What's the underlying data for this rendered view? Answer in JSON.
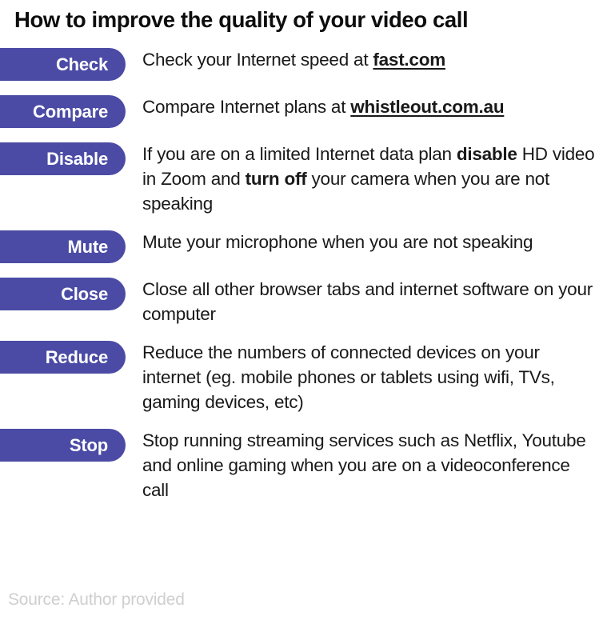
{
  "title": "How to improve the quality of your video call",
  "theme": {
    "pill_color": "#4b4ba6",
    "pill_text_color": "#ffffff",
    "title_color": "#0d0d0d",
    "body_text_color": "#191919",
    "source_color": "#cfcfcf",
    "background": "#ffffff"
  },
  "tips": [
    {
      "label": "Check",
      "text": "Check your Internet speed at fast.com",
      "segments": [
        {
          "text": "Check your Internet speed at ",
          "style": "normal"
        },
        {
          "text": "fast.com",
          "style": "link"
        }
      ]
    },
    {
      "label": "Compare",
      "text": "Compare Internet plans at whistleout.com.au",
      "segments": [
        {
          "text": "Compare Internet plans at ",
          "style": "normal"
        },
        {
          "text": "whistleout.com.au",
          "style": "link"
        }
      ]
    },
    {
      "label": "Disable",
      "text": "If you are on a limited Internet data plan disable HD video in Zoom and turn off your camera when you are not speaking",
      "segments": [
        {
          "text": "If you are on a limited Internet data plan ",
          "style": "normal"
        },
        {
          "text": "disable",
          "style": "bold"
        },
        {
          "text": " HD video in Zoom and ",
          "style": "normal"
        },
        {
          "text": "turn off",
          "style": "bold"
        },
        {
          "text": " your camera when you are not speaking",
          "style": "normal"
        }
      ]
    },
    {
      "label": "Mute",
      "text": "Mute your microphone when you are not speaking",
      "segments": [
        {
          "text": "Mute your microphone when you are not speaking",
          "style": "normal"
        }
      ]
    },
    {
      "label": "Close",
      "text": "Close all other browser tabs and internet software on your computer",
      "segments": [
        {
          "text": "Close all other browser tabs and internet software on your computer",
          "style": "normal"
        }
      ]
    },
    {
      "label": "Reduce",
      "text": "Reduce the numbers of connected devices on your internet (eg. mobile phones or tablets using wifi, TVs, gaming devices, etc)",
      "segments": [
        {
          "text": "Reduce the numbers of connected devices on your internet (eg. mobile phones or tablets using wifi, TVs, gaming devices, etc)",
          "style": "normal"
        }
      ]
    },
    {
      "label": "Stop",
      "text": "Stop running streaming services such as Netflix, Youtube and online gaming when you are on a videoconference call",
      "segments": [
        {
          "text": "Stop running streaming services such as Netflix, Youtube and online gaming when you are on a videoconference call",
          "style": "normal"
        }
      ]
    }
  ],
  "source": "Source: Author provided"
}
